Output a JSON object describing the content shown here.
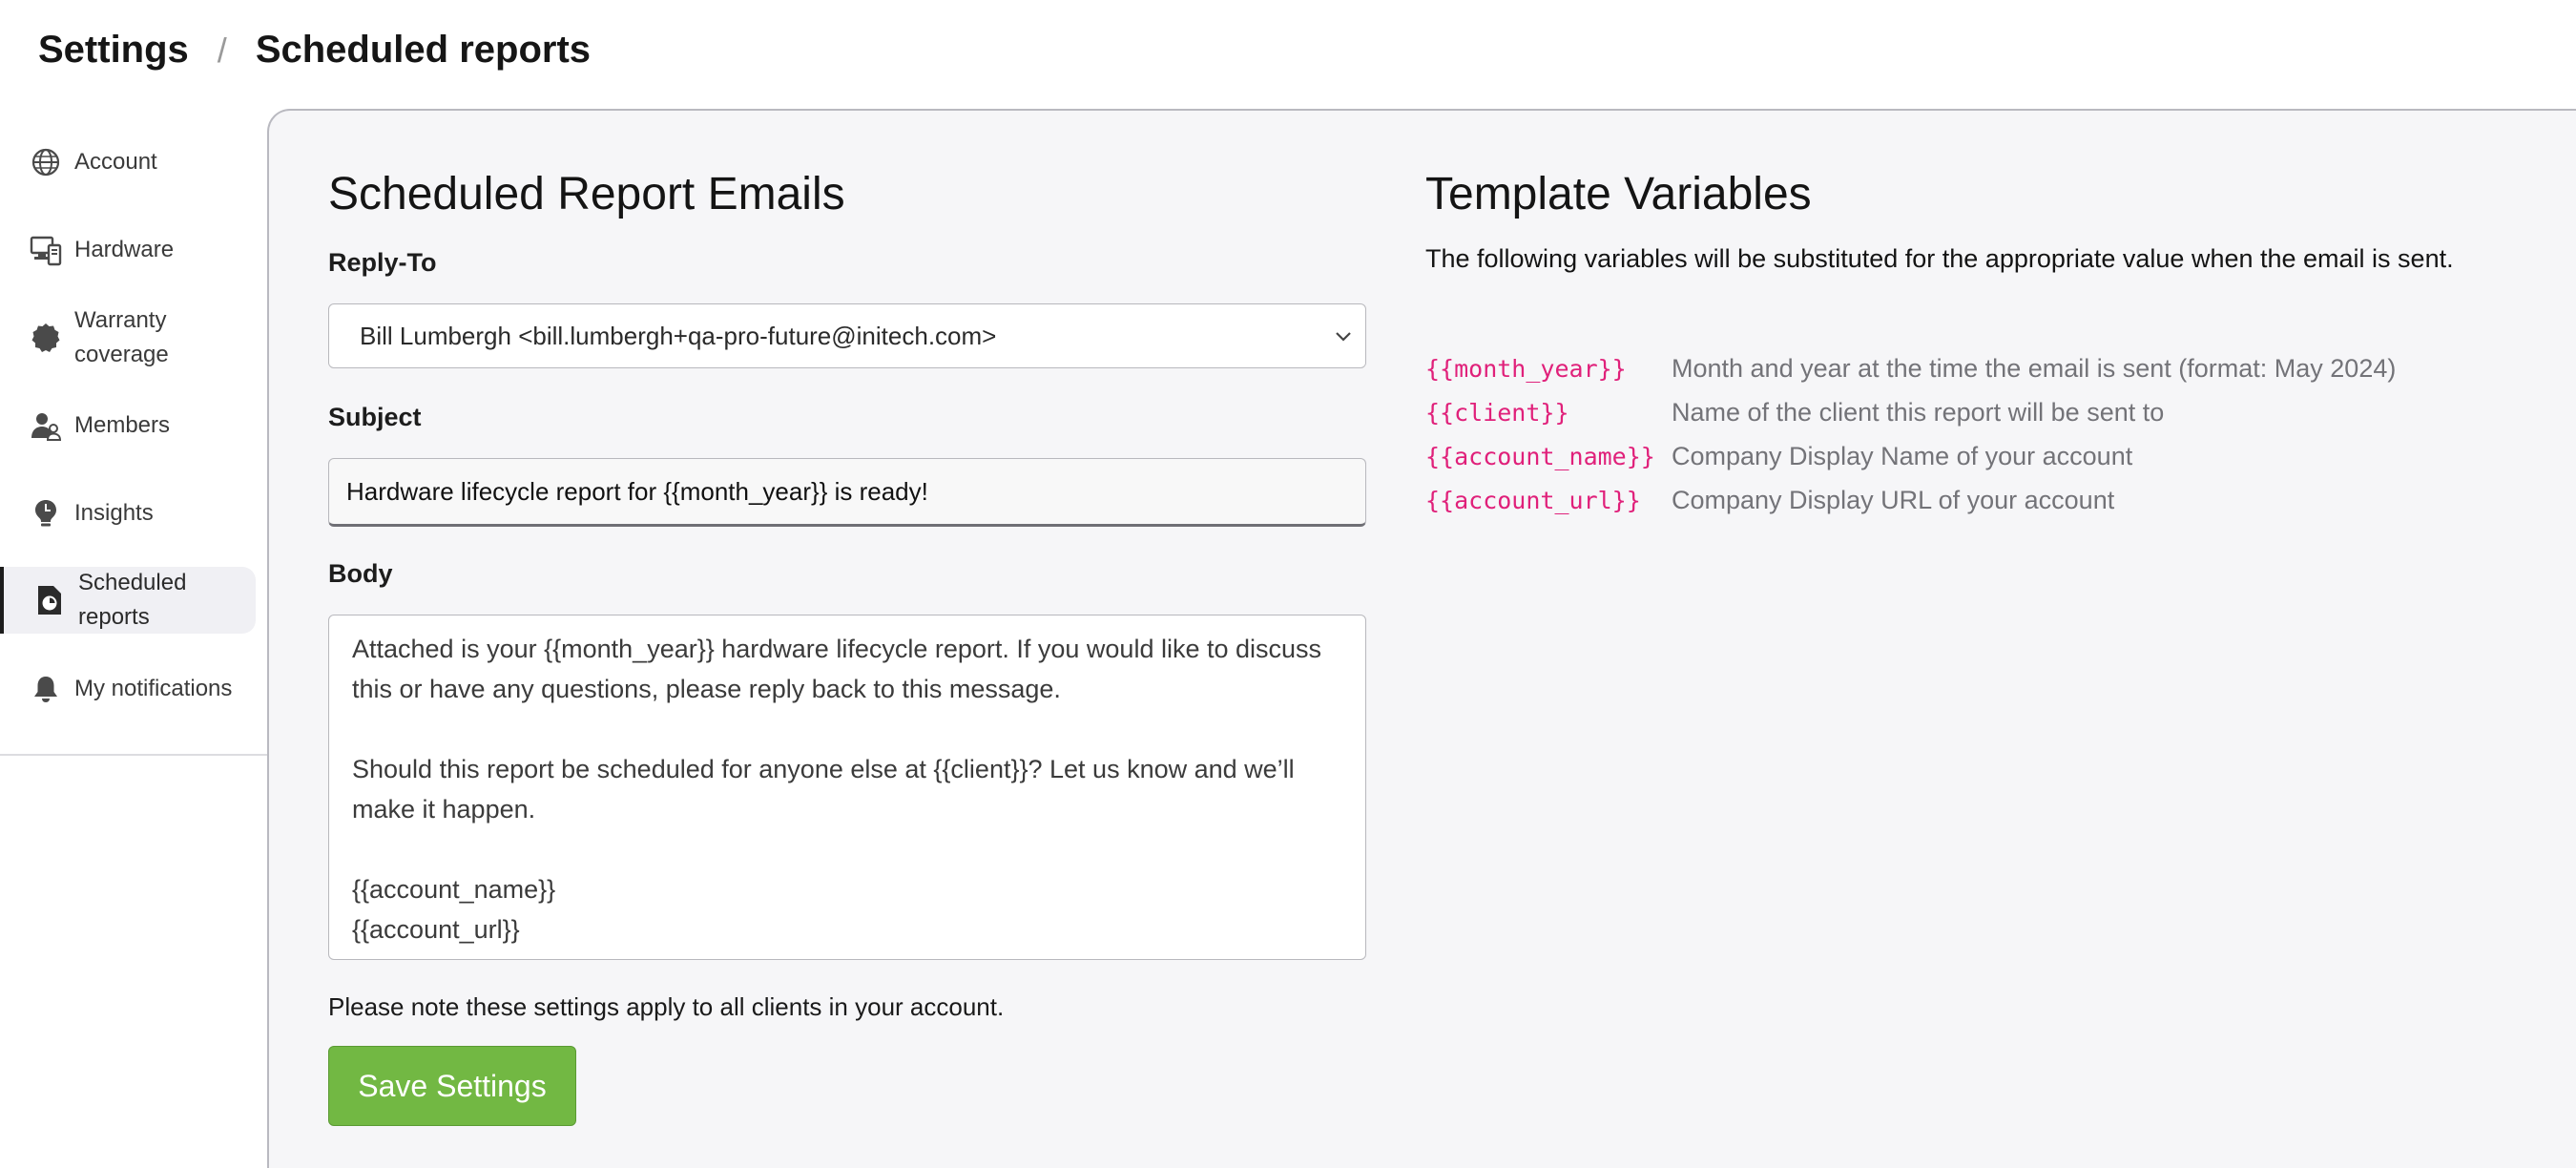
{
  "breadcrumb": {
    "root": "Settings",
    "separator": "/",
    "current": "Scheduled reports"
  },
  "sidebar": {
    "items": [
      {
        "label": "Account",
        "icon": "globe-icon"
      },
      {
        "label": "Hardware",
        "icon": "hardware-icon"
      },
      {
        "label": "Warranty coverage",
        "icon": "warranty-badge-icon"
      },
      {
        "label": "Members",
        "icon": "members-icon"
      },
      {
        "label": "Insights",
        "icon": "insights-bulb-icon"
      },
      {
        "label": "Scheduled reports",
        "icon": "scheduled-report-icon",
        "active": true
      },
      {
        "label": "My notifications",
        "icon": "bell-icon"
      }
    ]
  },
  "form": {
    "title": "Scheduled Report Emails",
    "reply_to_label": "Reply-To",
    "reply_to_value": "Bill Lumbergh <bill.lumbergh+qa-pro-future@initech.com>",
    "subject_label": "Subject",
    "subject_value": "Hardware lifecycle report for {{month_year}} is ready!",
    "body_label": "Body",
    "body_value": "Attached is your {{month_year}} hardware lifecycle report. If you would like to discuss this or have any questions, please reply back to this message.\n\nShould this report be scheduled for anyone else at {{client}}? Let us know and we’ll make it happen.\n\n{{account_name}}\n{{account_url}}",
    "note": "Please note these settings apply to all clients in your account.",
    "save_label": "Save Settings"
  },
  "variables": {
    "title": "Template Variables",
    "description": "The following variables will be substituted for the appropriate value when the email is sent.",
    "rows": [
      {
        "code": "{{month_year}}",
        "text": "Month and year at the time the email is sent (format: May 2024)"
      },
      {
        "code": "{{client}}",
        "text": "Name of the client this report will be sent to"
      },
      {
        "code": "{{account_name}}",
        "text": "Company Display Name of your account"
      },
      {
        "code": "{{account_url}}",
        "text": "Company Display URL of your account"
      }
    ]
  },
  "colors": {
    "accent_green": "#72b843",
    "variable_pink": "#e0207a",
    "panel_bg": "#f6f6f8"
  }
}
